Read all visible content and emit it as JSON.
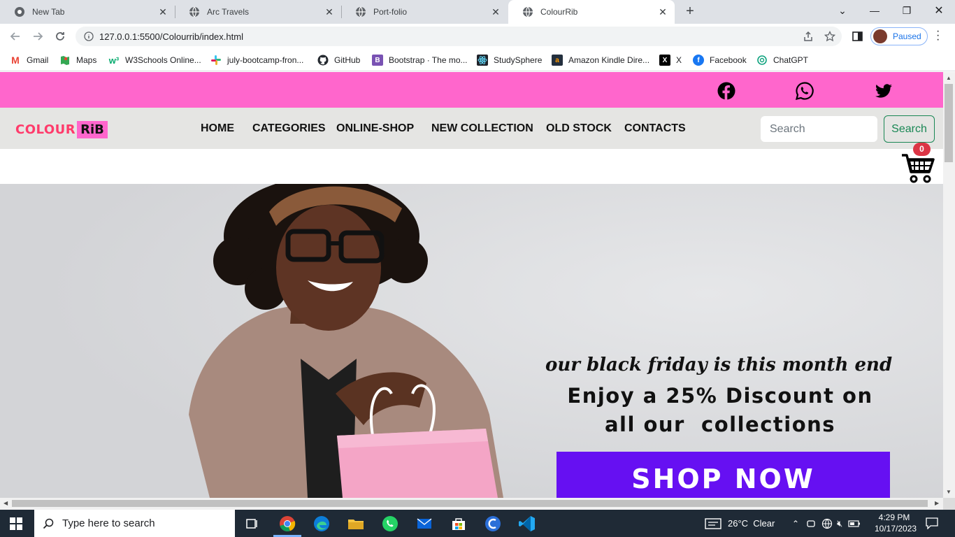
{
  "browser": {
    "tabs": [
      {
        "title": "New Tab",
        "icon": "chrome-icon",
        "active": false
      },
      {
        "title": "Arc Travels",
        "icon": "globe-icon",
        "active": false
      },
      {
        "title": "Port-folio",
        "icon": "globe-icon",
        "active": false
      },
      {
        "title": "ColourRib",
        "icon": "globe-icon",
        "active": true
      }
    ],
    "url": "127.0.0.1:5500/Colourrib/index.html",
    "profile_label": "Paused"
  },
  "bookmarks": [
    {
      "label": "Gmail",
      "icon": "gmail-icon",
      "color": "#ea4335"
    },
    {
      "label": "Maps",
      "icon": "maps-icon",
      "color": "#34a853"
    },
    {
      "label": "W3Schools Online...",
      "icon": "w3schools-icon",
      "color": "#04aa6d"
    },
    {
      "label": "july-bootcamp-fron...",
      "icon": "slack-icon",
      "color": "#e01e5a"
    },
    {
      "label": "GitHub",
      "icon": "github-icon",
      "color": "#24292f"
    },
    {
      "label": "Bootstrap · The mo...",
      "icon": "bootstrap-icon",
      "color": "#7952b3"
    },
    {
      "label": "StudySphere",
      "icon": "react-icon",
      "color": "#20232a"
    },
    {
      "label": "Amazon Kindle Dire...",
      "icon": "amazon-icon",
      "color": "#232f3e"
    },
    {
      "label": "X",
      "icon": "x-icon",
      "color": "#000000"
    },
    {
      "label": "Facebook",
      "icon": "facebook-icon",
      "color": "#1877f2"
    },
    {
      "label": "ChatGPT",
      "icon": "chatgpt-icon",
      "color": "#10a37f"
    }
  ],
  "site": {
    "logo": {
      "part1": "COLOUR",
      "part2": "RiB"
    },
    "colors": {
      "topbar": "#ff66cc",
      "navbar": "#e5e5e3",
      "accent": "#6610f2",
      "search_btn": "#198754",
      "badge": "#dc3545"
    },
    "social": [
      "facebook-icon",
      "whatsapp-icon",
      "twitter-icon"
    ],
    "menu": [
      "HOME",
      "CATEGORIES",
      "ONLINE-SHOP",
      "NEW COLLECTION",
      "OLD STOCK",
      "CONTACTS"
    ],
    "search": {
      "placeholder": "Search",
      "button": "Search"
    },
    "cart_count": "0",
    "hero": {
      "tagline": "our black friday is this month end",
      "headline_line1": "Enjoy a 25% Discount on",
      "headline_line2": "all our  collections",
      "cta": "SHOP NOW"
    }
  },
  "taskbar": {
    "search_placeholder": "Type here to search",
    "weather": "26°C  Clear",
    "time": "4:29 PM",
    "date": "10/17/2023"
  }
}
